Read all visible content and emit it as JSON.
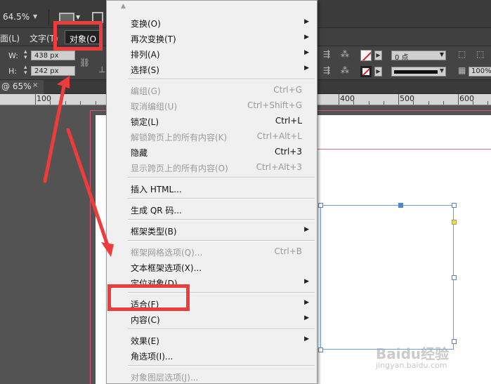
{
  "appbar": {
    "zoom": "64.5%"
  },
  "menubar": {
    "items": [
      "面(L)",
      "文字(T)",
      "对象(O"
    ]
  },
  "control": {
    "w_label": "W:",
    "w_value": "438 px",
    "h_label": "H:",
    "h_value": "242 px",
    "stroke_weight": "0 点",
    "opacity": "100%"
  },
  "doc_tab": {
    "label": "@ 65%",
    "close": "×"
  },
  "ruler": {
    "labels": [
      "100",
      "400",
      "500",
      "600"
    ]
  },
  "menu": {
    "items": [
      {
        "label": "变换(O)",
        "shortcut": "",
        "submenu": true,
        "disabled": false
      },
      {
        "label": "再次变换(T)",
        "shortcut": "",
        "submenu": true,
        "disabled": false
      },
      {
        "label": "排列(A)",
        "shortcut": "",
        "submenu": true,
        "disabled": false
      },
      {
        "label": "选择(S)",
        "shortcut": "",
        "submenu": true,
        "disabled": false
      },
      {
        "label": "编组(G)",
        "shortcut": "Ctrl+G",
        "submenu": false,
        "disabled": true
      },
      {
        "label": "取消编组(U)",
        "shortcut": "Ctrl+Shift+G",
        "submenu": false,
        "disabled": true
      },
      {
        "label": "锁定(L)",
        "shortcut": "Ctrl+L",
        "submenu": false,
        "disabled": false
      },
      {
        "label": "解锁跨页上的所有内容(K)",
        "shortcut": "Ctrl+Alt+L",
        "submenu": false,
        "disabled": true
      },
      {
        "label": "隐藏",
        "shortcut": "Ctrl+3",
        "submenu": false,
        "disabled": false
      },
      {
        "label": "显示跨页上的所有内容(O)",
        "shortcut": "Ctrl+Alt+3",
        "submenu": false,
        "disabled": true
      },
      {
        "label": "插入 HTML...",
        "shortcut": "",
        "submenu": false,
        "disabled": false
      },
      {
        "label": "生成 QR 码...",
        "shortcut": "",
        "submenu": false,
        "disabled": false
      },
      {
        "label": "框架类型(B)",
        "shortcut": "",
        "submenu": true,
        "disabled": false
      },
      {
        "label": "框架网格选项(Q)...",
        "shortcut": "Ctrl+B",
        "submenu": false,
        "disabled": true
      },
      {
        "label": "文本框架选项(X)...",
        "shortcut": "",
        "submenu": false,
        "disabled": false
      },
      {
        "label": "定位对象(D)",
        "shortcut": "",
        "submenu": true,
        "disabled": false
      },
      {
        "label": "适合(F)",
        "shortcut": "",
        "submenu": true,
        "disabled": false
      },
      {
        "label": "内容(C)",
        "shortcut": "",
        "submenu": true,
        "disabled": false
      },
      {
        "label": "效果(E)",
        "shortcut": "",
        "submenu": true,
        "disabled": false
      },
      {
        "label": "角选项(I)...",
        "shortcut": "",
        "submenu": false,
        "disabled": false
      },
      {
        "label": "对象图层选项(J)...",
        "shortcut": "",
        "submenu": false,
        "disabled": true
      }
    ]
  },
  "colors": {
    "annotation_red": "#ee3b3b",
    "selection_blue": "#4a86d6",
    "margin_pink": "#d86b8f"
  },
  "watermark": {
    "logo": "Baidu经验",
    "url": "jingyan.baidu.com"
  }
}
